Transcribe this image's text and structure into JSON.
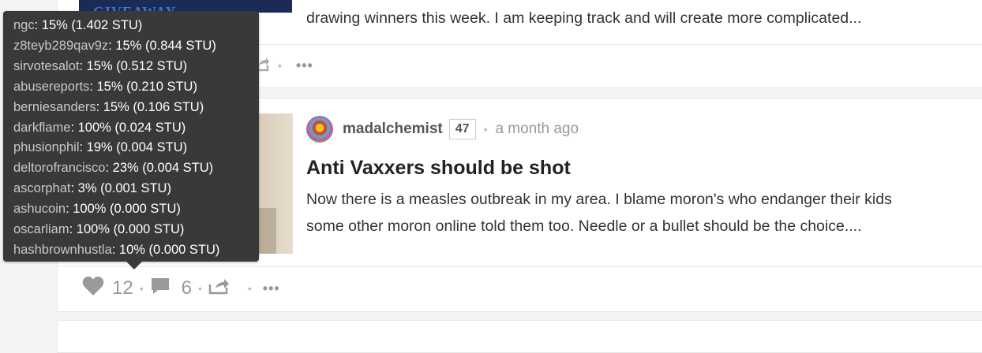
{
  "top_post": {
    "thumb_text": "RANDOM STEEM GIVEAWAY",
    "excerpt": "drawing winners this week. I am keeping track and will create more complicated...",
    "more_label": "•••"
  },
  "post": {
    "author": "madalchemist",
    "reputation": "47",
    "time_ago": "a month ago",
    "title": "Anti Vaxxers should be shot",
    "excerpt_line1": "Now there is a measles outbreak in my area. I blame moron's who endanger their kids",
    "excerpt_line2": "some other moron online told them too. Needle or a bullet should be the choice....",
    "votes": "12",
    "comments": "6",
    "more_label": "•••"
  },
  "voters": [
    {
      "name": "ngc",
      "detail": ": 15% (1.402 STU)"
    },
    {
      "name": "z8teyb289qav9z",
      "detail": ": 15% (0.844 STU)"
    },
    {
      "name": "sirvotesalot",
      "detail": ": 15% (0.512 STU)"
    },
    {
      "name": "abusereports",
      "detail": ": 15% (0.210 STU)"
    },
    {
      "name": "berniesanders",
      "detail": ": 15% (0.106 STU)"
    },
    {
      "name": "darkflame",
      "detail": ": 100% (0.024 STU)"
    },
    {
      "name": "phusionphil",
      "detail": ": 19% (0.004 STU)"
    },
    {
      "name": "deltorofrancisco",
      "detail": ": 23% (0.004 STU)"
    },
    {
      "name": "ascorphat",
      "detail": ": 3% (0.001 STU)"
    },
    {
      "name": "ashucoin",
      "detail": ": 100% (0.000 STU)"
    },
    {
      "name": "oscarliam",
      "detail": ": 100% (0.000 STU)"
    },
    {
      "name": "hashbrownhustla",
      "detail": ": 10% (0.000 STU)"
    }
  ],
  "colors": {
    "tooltip_bg": "#393939",
    "icon": "#999999"
  },
  "icons": [
    "heart-icon",
    "comment-icon",
    "share-icon",
    "more-icon"
  ]
}
